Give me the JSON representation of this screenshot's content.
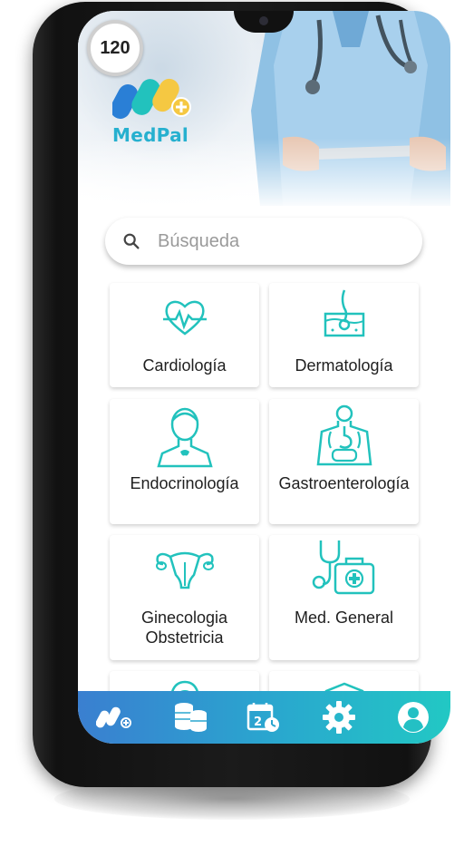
{
  "app": {
    "name": "MedPal",
    "counter": "120"
  },
  "search": {
    "placeholder": "Búsqueda",
    "icon": "search-icon"
  },
  "colors": {
    "accent": "#22c2bd",
    "nav_start": "#3a7fd0",
    "nav_end": "#22c8c4",
    "logo_text": "#26b0cf"
  },
  "specialties": [
    {
      "label": "Cardiología",
      "icon": "heart-monitor-icon"
    },
    {
      "label": "Dermatología",
      "icon": "skin-layer-icon"
    },
    {
      "label": "Endocrinología",
      "icon": "thyroid-person-icon"
    },
    {
      "label": "Gastroenterología",
      "icon": "digestive-system-icon"
    },
    {
      "label": "Ginecologia Obstetricia",
      "icon": "uterus-icon"
    },
    {
      "label": "Med. General",
      "icon": "stethoscope-kit-icon"
    }
  ],
  "bottom_nav": [
    {
      "name": "home",
      "icon": "medpal-logo-icon"
    },
    {
      "name": "payments",
      "icon": "coins-icon"
    },
    {
      "name": "appointments",
      "icon": "calendar-clock-icon"
    },
    {
      "name": "settings",
      "icon": "gear-icon"
    },
    {
      "name": "profile",
      "icon": "user-icon"
    }
  ]
}
